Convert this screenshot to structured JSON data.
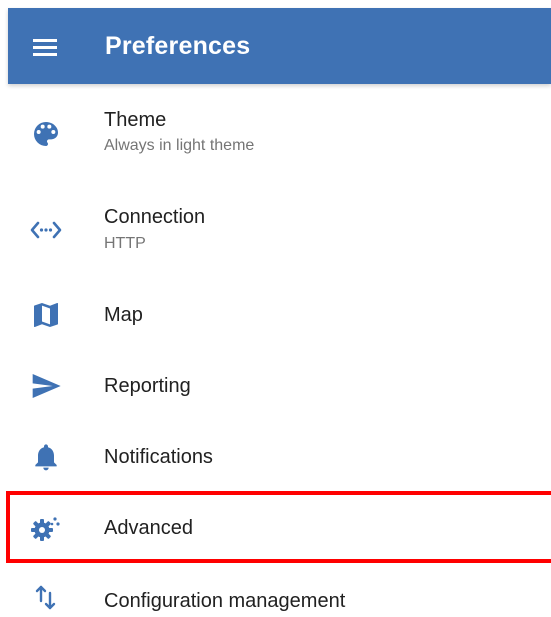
{
  "appbar": {
    "title": "Preferences",
    "menu_icon": "hamburger-menu-icon",
    "color": "#3f72b4"
  },
  "accent_color": "#3f72b4",
  "highlight_color": "#ff0000",
  "items": [
    {
      "icon": "palette-icon",
      "title": "Theme",
      "subtitle": "Always in light theme"
    },
    {
      "icon": "connection-code-icon",
      "title": "Connection",
      "subtitle": "HTTP"
    },
    {
      "icon": "map-icon",
      "title": "Map"
    },
    {
      "icon": "send-icon",
      "title": "Reporting"
    },
    {
      "icon": "bell-icon",
      "title": "Notifications"
    },
    {
      "icon": "gear-sparkle-icon",
      "title": "Advanced",
      "highlighted": true
    },
    {
      "icon": "import-export-arrows-icon",
      "title": "Configuration management"
    }
  ]
}
